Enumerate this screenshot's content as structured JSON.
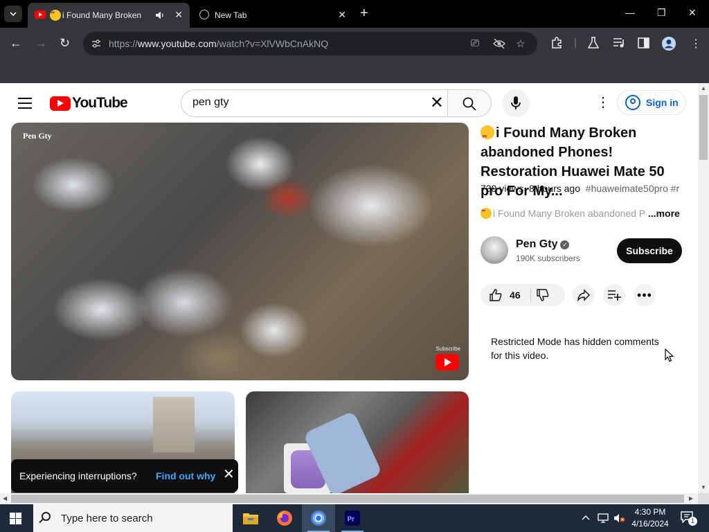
{
  "browser": {
    "tabs": [
      {
        "title": "i Found Many Broken abandoned Phones! Restoration Huawei Mate 50 pro For My...",
        "active": true
      },
      {
        "title": "New Tab",
        "active": false
      }
    ],
    "url_prefix": "https://",
    "url_host": "www.youtube.com",
    "url_path": "/watch?v=XlVWbCnAkNQ"
  },
  "youtube": {
    "logo_text": "YouTube",
    "search_value": "pen gty",
    "sign_in_label": "Sign in",
    "player": {
      "watermark": "Pen Gty",
      "subscribe_watermark": "Subscribe"
    },
    "video": {
      "title": "i Found Many Broken abandoned Phones! Restoration Huawei Mate 50 pro For My...",
      "views": "739 views",
      "posted": "8 hours ago",
      "tags": "#huaweimate50pro #r",
      "description_visible": "i Found Many Broken abandoned P",
      "more_label": "...more"
    },
    "channel": {
      "name": "Pen Gty",
      "subscribers": "190K subscribers",
      "subscribe_label": "Subscribe"
    },
    "likes": "46",
    "restricted_notice": "Restricted Mode has hidden comments for this video.",
    "toast": {
      "text": "Experiencing interruptions?",
      "link": "Find out why"
    }
  },
  "taskbar": {
    "search_placeholder": "Type here to search",
    "time": "4:30 PM",
    "date": "4/16/2024",
    "notification_count": "1"
  },
  "colors": {
    "youtube_red": "#ff0000",
    "link_blue": "#065fd4",
    "toast_link": "#3ea6ff",
    "taskbar": "#1c2a3a"
  }
}
